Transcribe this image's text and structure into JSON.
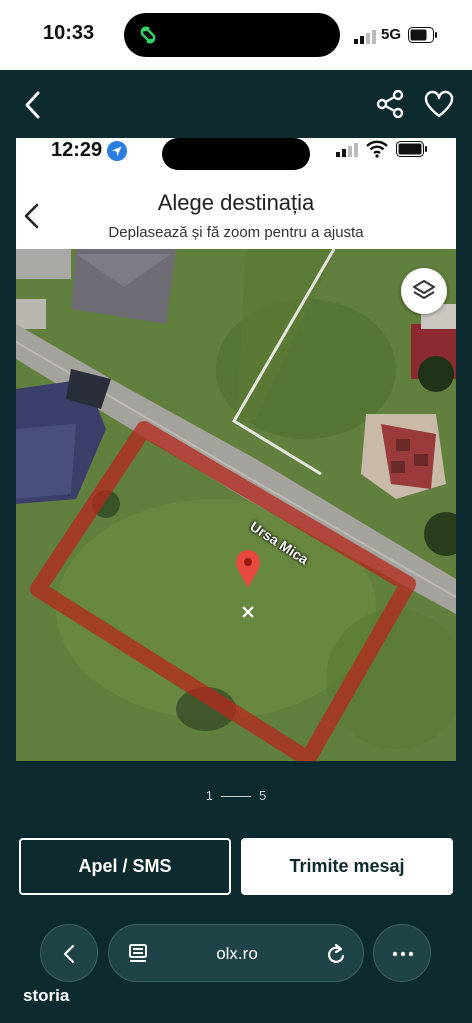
{
  "status_bar": {
    "time": "10:33",
    "network": "5G"
  },
  "header": {
    "back_icon": "chevron-left-icon",
    "share_icon": "share-icon",
    "favorite_icon": "heart-icon"
  },
  "photo": {
    "inner_status": {
      "time": "12:29"
    },
    "title": "Alege destinația",
    "subtitle": "Deplasează și fă zoom pentru a ajusta",
    "street_label": "Ursa Mica",
    "layers_icon": "layers-icon",
    "pin_icon": "location-pin-icon"
  },
  "pager": {
    "current": "1",
    "total": "5"
  },
  "actions": {
    "call_label": "Apel / SMS",
    "message_label": "Trimite mesaj"
  },
  "browser": {
    "url": "olx.ro"
  },
  "brand": {
    "name": "storia"
  },
  "colors": {
    "background": "#0d2a2e",
    "button_fill": "#ffffff",
    "plot_outline": "#b5271c"
  }
}
